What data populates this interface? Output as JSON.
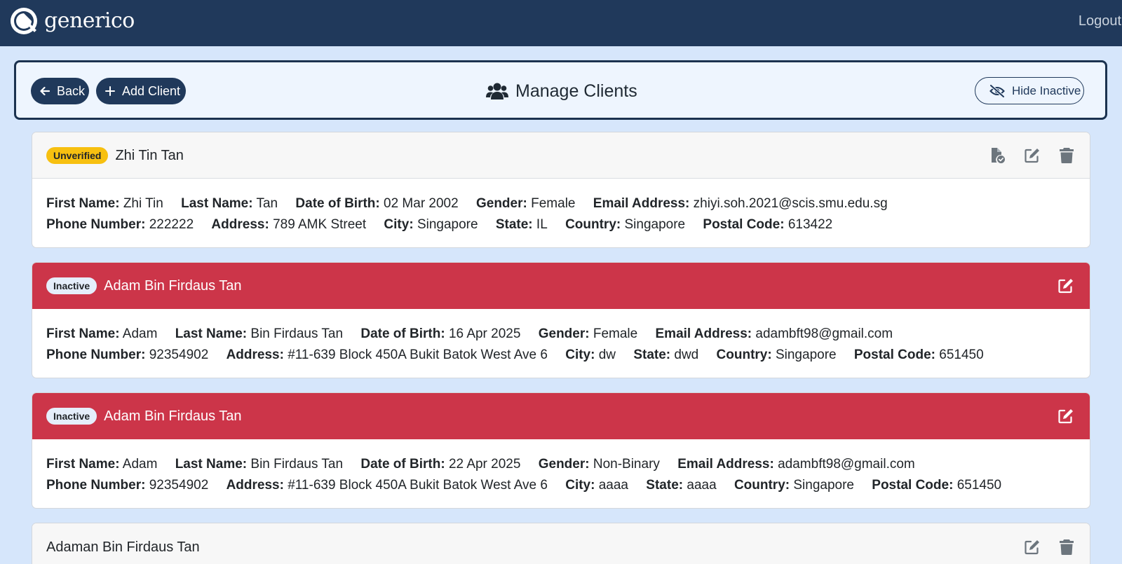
{
  "navbar": {
    "brand": "generico",
    "logout_label": "Logout"
  },
  "header": {
    "back_label": "Back",
    "add_label": "Add Client",
    "title": "Manage Clients",
    "hide_inactive_label": "Hide Inactive"
  },
  "labels": {
    "first_name": "First Name:",
    "last_name": "Last Name:",
    "dob": "Date of Birth:",
    "gender": "Gender:",
    "email": "Email Address:",
    "phone": "Phone Number:",
    "address": "Address:",
    "city": "City:",
    "state": "State:",
    "country": "Country:",
    "postal": "Postal Code:"
  },
  "clients": [
    {
      "badge": "Unverified",
      "name": "Zhi Tin Tan",
      "first_name": "Zhi Tin",
      "last_name": "Tan",
      "dob": "02 Mar 2002",
      "gender": "Female",
      "email": "zhiyi.soh.2021@scis.smu.edu.sg",
      "phone": "222222",
      "address": "789 AMK Street",
      "city": "Singapore",
      "state": "IL",
      "country": "Singapore",
      "postal": "613422"
    },
    {
      "badge": "Inactive",
      "name": "Adam Bin Firdaus Tan",
      "first_name": "Adam",
      "last_name": "Bin Firdaus Tan",
      "dob": "16 Apr 2025",
      "gender": "Female",
      "email": "adambft98@gmail.com",
      "phone": "92354902",
      "address": "#11-639 Block 450A Bukit Batok West Ave 6",
      "city": "dw",
      "state": "dwd",
      "country": "Singapore",
      "postal": "651450"
    },
    {
      "badge": "Inactive",
      "name": "Adam Bin Firdaus Tan",
      "first_name": "Adam",
      "last_name": "Bin Firdaus Tan",
      "dob": "22 Apr 2025",
      "gender": "Non-Binary",
      "email": "adambft98@gmail.com",
      "phone": "92354902",
      "address": "#11-639 Block 450A Bukit Batok West Ave 6",
      "city": "aaaa",
      "state": "aaaa",
      "country": "Singapore",
      "postal": "651450"
    },
    {
      "name": "Adaman Bin Firdaus Tan"
    }
  ],
  "colors": {
    "navbar": "#20395b",
    "background": "#d6e6fb",
    "inactive_header": "#cc3549",
    "unverified_badge": "#f7c010"
  }
}
